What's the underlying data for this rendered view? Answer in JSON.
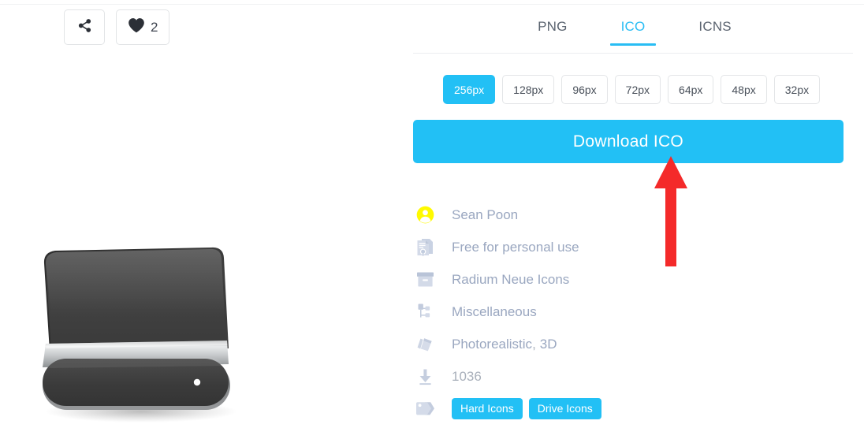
{
  "actions": {
    "share": {
      "label": "",
      "icon": "share-icon"
    },
    "like": {
      "count": "2",
      "icon": "heart-icon"
    }
  },
  "preview": {
    "icon_name": "hard-drive-icon",
    "description": "Photorealistic 3D external hard drive"
  },
  "formats": {
    "tabs": [
      {
        "label": "PNG",
        "active": false
      },
      {
        "label": "ICO",
        "active": true
      },
      {
        "label": "ICNS",
        "active": false
      }
    ]
  },
  "sizes": {
    "options": [
      {
        "label": "256px",
        "active": true
      },
      {
        "label": "128px",
        "active": false
      },
      {
        "label": "96px",
        "active": false
      },
      {
        "label": "72px",
        "active": false
      },
      {
        "label": "64px",
        "active": false
      },
      {
        "label": "48px",
        "active": false
      },
      {
        "label": "32px",
        "active": false
      }
    ]
  },
  "download": {
    "label": "Download ICO"
  },
  "annotation": {
    "type": "arrow",
    "direction": "up",
    "color": "#f42a2a",
    "points_to": "download-button"
  },
  "meta": {
    "author": {
      "icon": "user-avatar-icon",
      "value": "Sean Poon"
    },
    "license": {
      "icon": "license-document-icon",
      "value": "Free for personal use"
    },
    "iconset": {
      "icon": "package-box-icon",
      "value": "Radium Neue Icons"
    },
    "category": {
      "icon": "hierarchy-tree-icon",
      "value": "Miscellaneous"
    },
    "style": {
      "icon": "style-cards-icon",
      "values": [
        "Photorealistic",
        "3D"
      ],
      "separator": ","
    },
    "downloads": {
      "icon": "download-arrow-icon",
      "value": "1036"
    },
    "tags": {
      "icon": "tags-icon",
      "values": [
        "Hard Icons",
        "Drive Icons"
      ]
    }
  },
  "colors": {
    "accent": "#22c0f5",
    "tab_active": "#29bdf4",
    "meta_link": "#9aa7c0",
    "meta_text": "#a9b0bb",
    "annotation_red": "#f42a2a",
    "avatar_yellow": "#fffa00"
  }
}
